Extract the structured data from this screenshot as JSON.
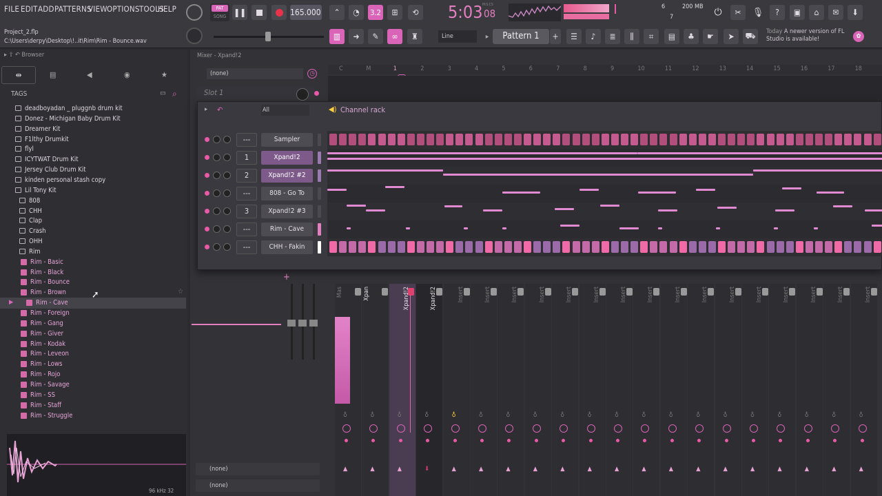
{
  "menu": {
    "items": [
      "FILE",
      "EDIT",
      "ADD",
      "PATTERNS",
      "VIEW",
      "OPTIONS",
      "TOOLS",
      "HELP"
    ]
  },
  "transport": {
    "pat": "PAT",
    "song": "SONG",
    "tempo": "165.000",
    "time_main": "5:03",
    "time_sub": "08",
    "time_label": "M:S:CS",
    "mem": "200 MB",
    "cpu_a": "6",
    "cpu_b": "7"
  },
  "project": {
    "name": "Project_2.flp",
    "path": "C:\\Users\\derpy\\Desktop\\!..it\\Rim\\Rim - Bounce.wav"
  },
  "toolbar": {
    "snap": "Line",
    "pattern": "Pattern 1",
    "news_prefix": "Today",
    "news": "A newer version of FL Studio is available!",
    "step_label": "3.2"
  },
  "browser": {
    "title": "Browser",
    "tags": "TAGS",
    "sample_rate": "96 kHz 32",
    "items": [
      {
        "label": "deadboyadan _ pluggnb drum kit",
        "type": "folder",
        "indent": 1
      },
      {
        "label": "Donez - Michigan Baby Drum Kit",
        "type": "folder",
        "indent": 1
      },
      {
        "label": "Dreamer Kit",
        "type": "folder",
        "indent": 1
      },
      {
        "label": "F1lthy Drumkit",
        "type": "folder",
        "indent": 1
      },
      {
        "label": "flyl",
        "type": "folder",
        "indent": 1
      },
      {
        "label": "ICYTWAT Drum Kit",
        "type": "folder",
        "indent": 1
      },
      {
        "label": "Jersey Club Drum Kit",
        "type": "folder",
        "indent": 1
      },
      {
        "label": "kinden personal stash copy",
        "type": "folder",
        "indent": 1
      },
      {
        "label": "Lil Tony Kit",
        "type": "folder",
        "indent": 1
      },
      {
        "label": "808",
        "type": "folder",
        "indent": 2
      },
      {
        "label": "CHH",
        "type": "folder",
        "indent": 2
      },
      {
        "label": "Clap",
        "type": "folder",
        "indent": 2
      },
      {
        "label": "Crash",
        "type": "folder",
        "indent": 2
      },
      {
        "label": "OHH",
        "type": "folder",
        "indent": 2
      },
      {
        "label": "Rim",
        "type": "folder",
        "indent": 2
      },
      {
        "label": "Rim - Basic",
        "type": "wav",
        "indent": 3
      },
      {
        "label": "Rim - Black",
        "type": "wav",
        "indent": 3
      },
      {
        "label": "Rim - Bounce",
        "type": "wav",
        "indent": 3
      },
      {
        "label": "Rim - Brown",
        "type": "wav",
        "indent": 3
      },
      {
        "label": "Rim - Cave",
        "type": "wav",
        "indent": 4
      },
      {
        "label": "Rim - Foreign",
        "type": "wav",
        "indent": 3
      },
      {
        "label": "Rim - Gang",
        "type": "wav",
        "indent": 3
      },
      {
        "label": "Rim - Giver",
        "type": "wav",
        "indent": 3
      },
      {
        "label": "Rim - Kodak",
        "type": "wav",
        "indent": 3
      },
      {
        "label": "Rim - Leveon",
        "type": "wav",
        "indent": 3
      },
      {
        "label": "Rim - Lows",
        "type": "wav",
        "indent": 3
      },
      {
        "label": "Rim - Rojo",
        "type": "wav",
        "indent": 3
      },
      {
        "label": "Rim - Savage",
        "type": "wav",
        "indent": 3
      },
      {
        "label": "Rim - SS",
        "type": "wav",
        "indent": 3
      },
      {
        "label": "Rim - Staff",
        "type": "wav",
        "indent": 3
      },
      {
        "label": "Rim - Struggle",
        "type": "wav",
        "indent": 3
      }
    ]
  },
  "mixer": {
    "title": "Mixer - Xpand!2",
    "slot": "Slot 1",
    "none_top": "(none)",
    "none_bottom1": "(none)",
    "none_bottom2": "(none)",
    "ruler": [
      "C",
      "M",
      "1",
      "2",
      "3",
      "4",
      "5",
      "6",
      "7",
      "8",
      "9",
      "10",
      "11",
      "12",
      "13",
      "14",
      "15",
      "16",
      "17",
      "18"
    ],
    "strips": [
      "Mas",
      "Xpan",
      "Xpand!2",
      "Xpand!2",
      "Insert",
      "Insert",
      "Insert",
      "Insert",
      "Insert",
      "Insert",
      "Insert",
      "Insert",
      "Insert",
      "Insert",
      "Insert",
      "Insert",
      "Insert",
      "Insert",
      "Insert",
      "Insert"
    ]
  },
  "channel_rack": {
    "title": "Channel rack",
    "filter": "All",
    "add": "+",
    "channels": [
      {
        "name": "Sampler",
        "num": "---",
        "mode": "steps",
        "selected": false
      },
      {
        "name": "Xpand!2",
        "num": "1",
        "mode": "roll",
        "selected": true
      },
      {
        "name": "Xpand!2 #2",
        "num": "2",
        "mode": "roll",
        "selected": true
      },
      {
        "name": "808 - Go To",
        "num": "---",
        "mode": "roll",
        "selected": false
      },
      {
        "name": "Xpand!2 #3",
        "num": "3",
        "mode": "roll",
        "selected": false
      },
      {
        "name": "Rim - Cave",
        "num": "---",
        "mode": "roll",
        "selected": false
      },
      {
        "name": "CHH - Fakin",
        "num": "---",
        "mode": "steps2",
        "selected": false
      }
    ]
  },
  "colors": {
    "accent": "#e05fb5",
    "bg": "#2b2a2e",
    "panel": "#3a393f"
  }
}
